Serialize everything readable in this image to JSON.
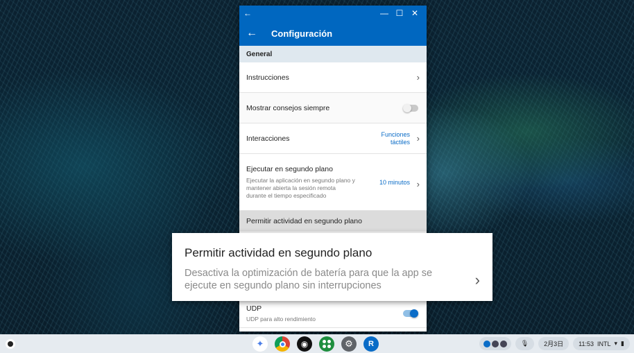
{
  "titlebar": {
    "back_glyph": "←",
    "minimize_glyph": "—",
    "maximize_glyph": "☐",
    "close_glyph": "✕"
  },
  "appbar": {
    "back_glyph": "←",
    "title": "Configuración"
  },
  "settings": {
    "section_header": "General",
    "instrucciones": {
      "title": "Instrucciones"
    },
    "consejos": {
      "title": "Mostrar consejos siempre",
      "toggle_on": false
    },
    "interacciones": {
      "title": "Interacciones",
      "value_line1": "Funciones",
      "value_line2": "táctiles"
    },
    "ejecutar": {
      "title": "Ejecutar en segundo plano",
      "description": "Ejecutar la aplicación en segundo plano y mantener abierta la sesión remota durante el tiempo especificado",
      "value": "10 minutos"
    },
    "permitir": {
      "title": "Permitir actividad en segundo plano"
    },
    "udp": {
      "title": "UDP",
      "description": "UDP para alto rendimiento",
      "toggle_on": true
    }
  },
  "callout": {
    "title": "Permitir actividad en segundo plano",
    "description": "Desactiva la optimización de batería para que la app se ejecute en segundo plano sin interrupciones"
  },
  "shelf": {
    "tray": {
      "mic_glyph": "🎙",
      "date": "2月3日",
      "time": "11:53",
      "ime": "INTL"
    }
  },
  "icons": {
    "chevron": "›",
    "assistant": "✦",
    "settings_gear": "⚙",
    "podcast": "◉",
    "remote_desktop": "R",
    "wifi": "▾",
    "battery": "▮"
  },
  "colors": {
    "accent": "#0067c0",
    "link": "#0a6cc7",
    "shelf": "#e6ebf0",
    "section_header_bg": "#dfe8ef"
  }
}
